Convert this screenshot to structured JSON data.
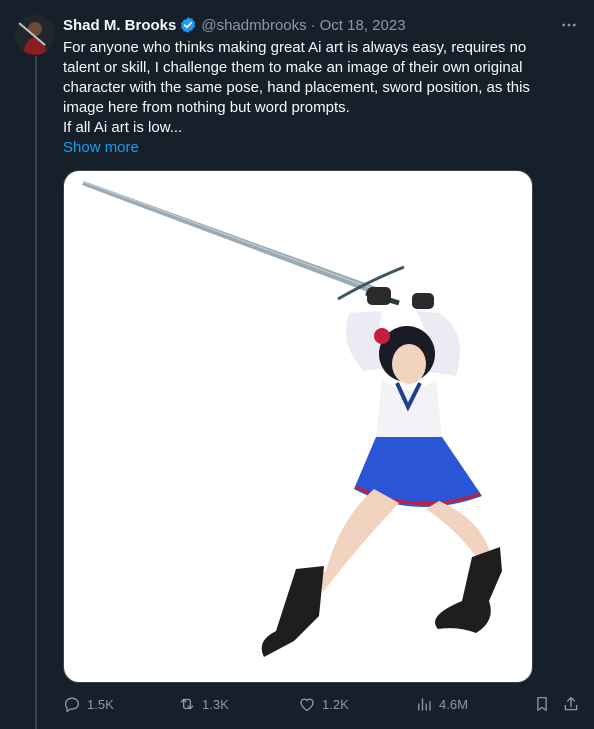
{
  "author": {
    "display_name": "Shad M. Brooks",
    "handle": "@shadmbrooks",
    "separator": "·",
    "date": "Oct 18, 2023",
    "verified": true
  },
  "tweet": {
    "text": "For anyone who thinks making great Ai art is always easy, requires no talent or skill, I challenge them to make an image of their own original character with the same pose, hand placement, sword position, as this image here from nothing but word prompts.\nIf all Ai art is low...",
    "show_more": "Show more"
  },
  "actions": {
    "replies": "1.5K",
    "retweets": "1.3K",
    "likes": "1.2K",
    "views": "4.6M"
  },
  "icons": {
    "more": "more-dots-icon",
    "verified": "verified-badge-icon",
    "reply": "reply-icon",
    "retweet": "retweet-icon",
    "like": "heart-icon",
    "views": "analytics-icon",
    "bookmark": "bookmark-icon",
    "share": "share-icon"
  },
  "colors": {
    "background": "#15202b",
    "accent": "#1d9bf0",
    "muted": "#8b98a5",
    "divider": "#38444d"
  }
}
